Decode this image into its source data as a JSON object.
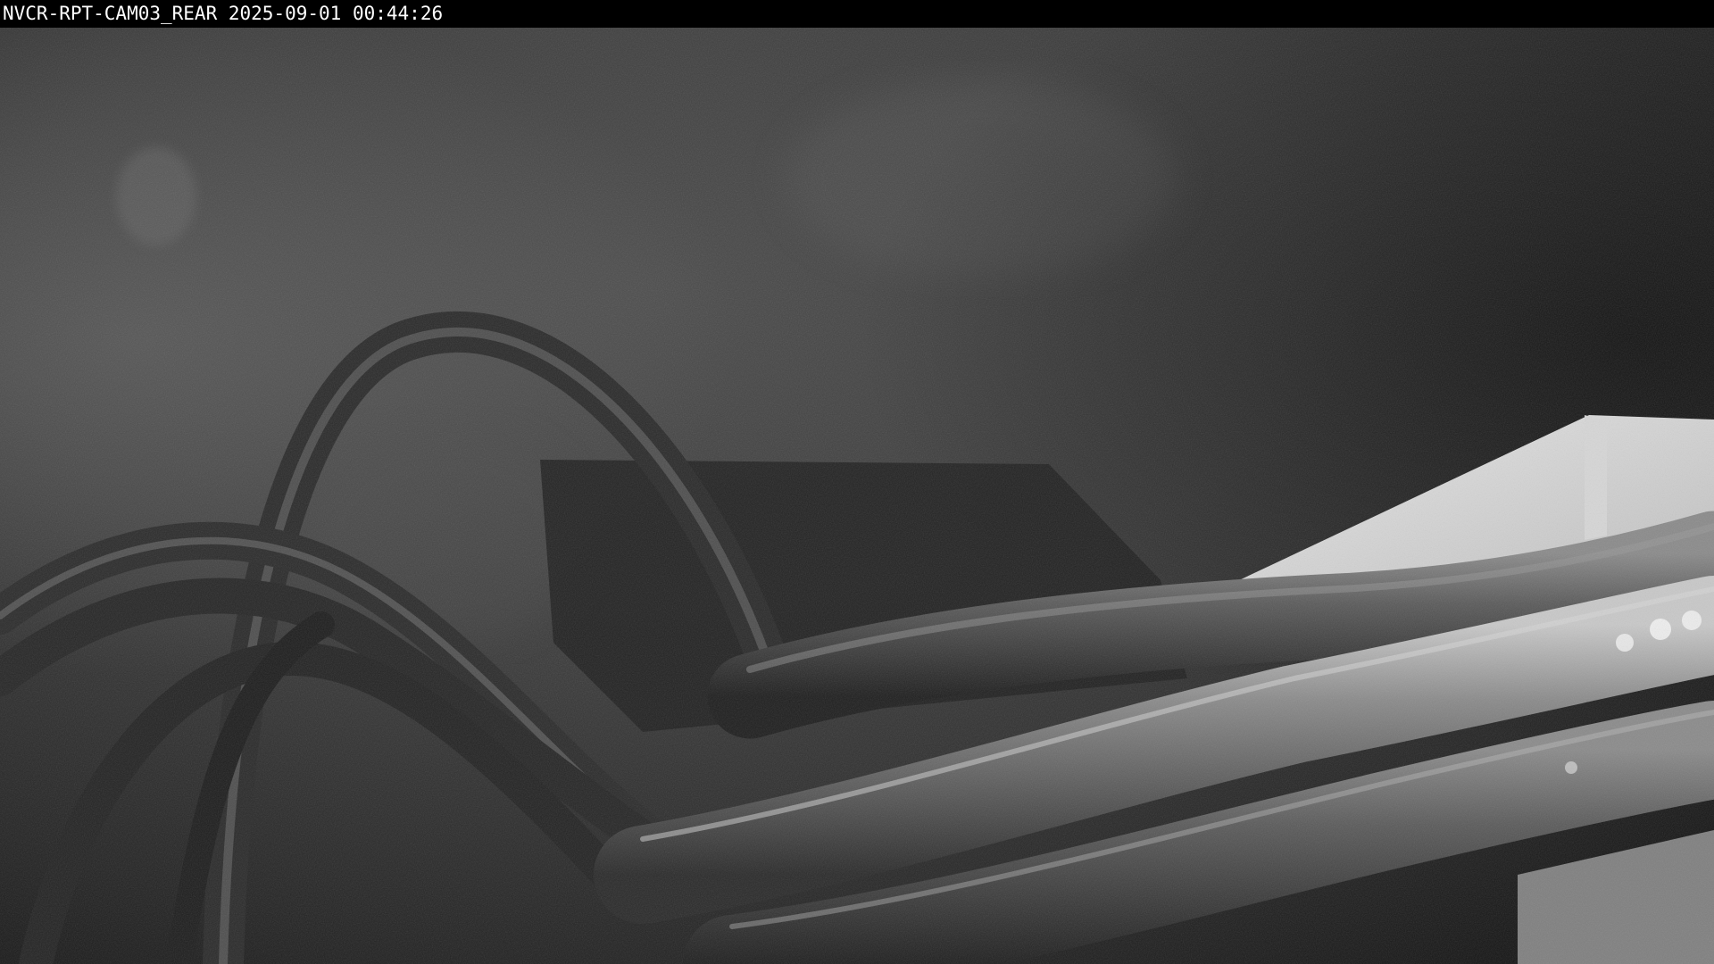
{
  "overlay": {
    "camera_id": "NVCR-RPT-CAM03_REAR",
    "date": "2025-09-01",
    "time": "00:44:26"
  },
  "scene": {
    "mode": "night-infrared-grayscale",
    "subjects": [
      "cable-bundle",
      "junction-box",
      "concrete-wall"
    ]
  }
}
